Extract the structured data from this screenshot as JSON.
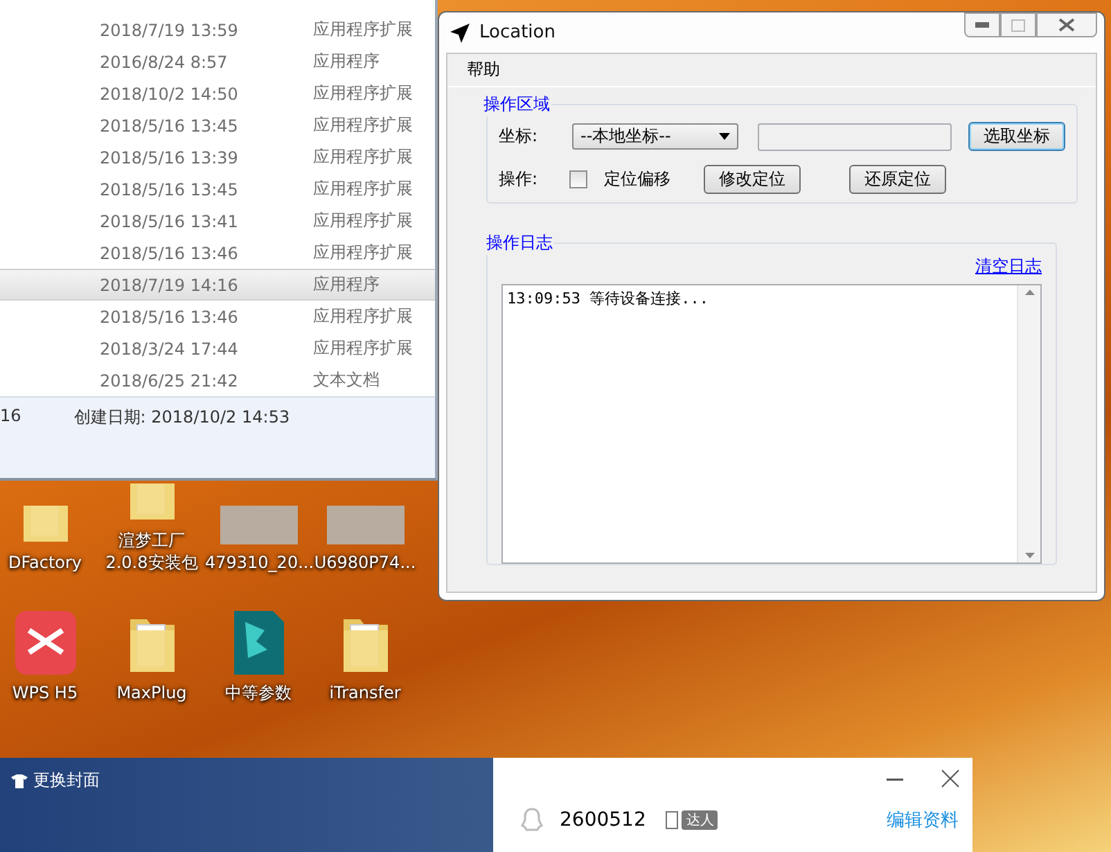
{
  "explorer": {
    "rows": [
      {
        "date": "2018/7/19 13:59",
        "type": "应用程序扩展",
        "selected": false
      },
      {
        "date": "2016/8/24 8:57",
        "type": "应用程序",
        "selected": false
      },
      {
        "date": "2018/10/2 14:50",
        "type": "应用程序扩展",
        "selected": false
      },
      {
        "date": "2018/5/16 13:45",
        "type": "应用程序扩展",
        "selected": false
      },
      {
        "date": "2018/5/16 13:39",
        "type": "应用程序扩展",
        "selected": false
      },
      {
        "date": "2018/5/16 13:45",
        "type": "应用程序扩展",
        "selected": false
      },
      {
        "date": "2018/5/16 13:41",
        "type": "应用程序扩展",
        "selected": false
      },
      {
        "date": "2018/5/16 13:46",
        "type": "应用程序扩展",
        "selected": false
      },
      {
        "date": "2018/7/19 14:16",
        "type": "应用程序",
        "selected": true
      },
      {
        "date": "2018/5/16 13:46",
        "type": "应用程序扩展",
        "selected": false
      },
      {
        "date": "2018/3/24 17:44",
        "type": "应用程序扩展",
        "selected": false
      },
      {
        "date": "2018/6/25 21:42",
        "type": "文本文档",
        "selected": false
      }
    ],
    "details": {
      "fragment": "16",
      "created_label": "创建日期:",
      "created_value": "2018/10/2 14:53"
    }
  },
  "location_window": {
    "title": "Location",
    "menu": [
      "帮助"
    ],
    "operation_group": {
      "title": "操作区域",
      "coord_label": "坐标:",
      "coord_select": "--本地坐标--",
      "pick_button": "选取坐标",
      "action_label": "操作:",
      "offset_checkbox": {
        "label": "定位偏移",
        "checked": false
      },
      "buttons": [
        "修改定位",
        "还原定位"
      ]
    },
    "log_group": {
      "title": "操作日志",
      "clear_link": "清空日志",
      "lines": [
        "13:09:53 等待设备连接..."
      ]
    }
  },
  "desktop_icons": [
    {
      "label": "DFactory",
      "kind": "folder"
    },
    {
      "label": "渲梦工厂 2.0.8安装包",
      "kind": "folder"
    },
    {
      "label": "479310_20...",
      "kind": "image"
    },
    {
      "label": "U6980P74...",
      "kind": "image"
    },
    {
      "label": "WPS H5",
      "kind": "app"
    },
    {
      "label": "MaxPlug",
      "kind": "folder"
    },
    {
      "label": "中等参数",
      "kind": "rps"
    },
    {
      "label": "iTransfer",
      "kind": "folder"
    }
  ],
  "qq_panel": {
    "cover_button": "更换封面",
    "qq_number": "2600512",
    "badge": "达人",
    "edit_link": "编辑资料"
  }
}
